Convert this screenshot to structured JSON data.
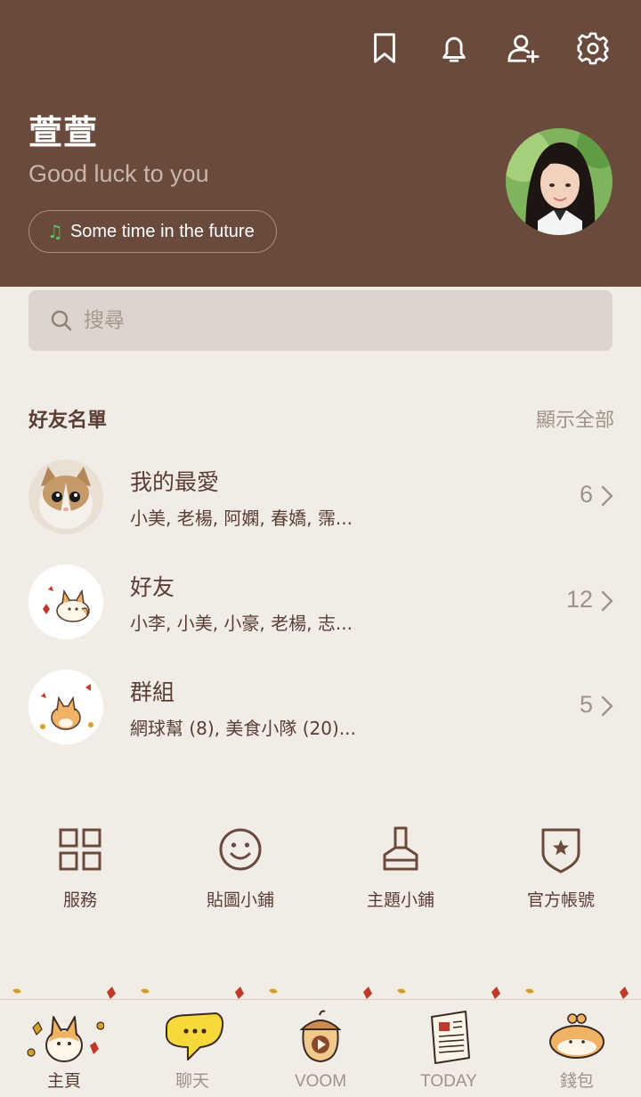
{
  "header": {
    "icons": [
      "bookmark-icon",
      "bell-icon",
      "add-friend-icon",
      "gear-icon"
    ],
    "name": "萱萱",
    "status": "Good luck to you",
    "music": "Some time in the future"
  },
  "search": {
    "placeholder": "搜尋"
  },
  "friends": {
    "title": "好友名單",
    "show_all": "顯示全部",
    "rows": [
      {
        "title": "我的最愛",
        "sub": "小美, 老楊, 阿嫻, 春嬌, 霈...",
        "count": "6"
      },
      {
        "title": "好友",
        "sub": "小李, 小美, 小豪, 老楊, 志...",
        "count": "12"
      },
      {
        "title": "群組",
        "sub": "網球幫 (8), 美食小隊 (20)...",
        "count": "5"
      }
    ]
  },
  "services": [
    {
      "label": "服務",
      "icon": "grid-icon"
    },
    {
      "label": "貼圖小鋪",
      "icon": "smiley-icon"
    },
    {
      "label": "主題小鋪",
      "icon": "brush-icon"
    },
    {
      "label": "官方帳號",
      "icon": "shield-star-icon"
    }
  ],
  "nav": [
    {
      "label": "主頁",
      "icon": "corgi-home-icon"
    },
    {
      "label": "聊天",
      "icon": "chat-bubble-icon"
    },
    {
      "label": "VOOM",
      "icon": "acorn-play-icon"
    },
    {
      "label": "TODAY",
      "icon": "newspaper-icon"
    },
    {
      "label": "錢包",
      "icon": "wallet-bun-icon"
    }
  ],
  "colors": {
    "header_bg": "#6a4a3c",
    "page_bg": "#f1ece6",
    "text": "#5a3e33",
    "muted": "#a09288"
  }
}
